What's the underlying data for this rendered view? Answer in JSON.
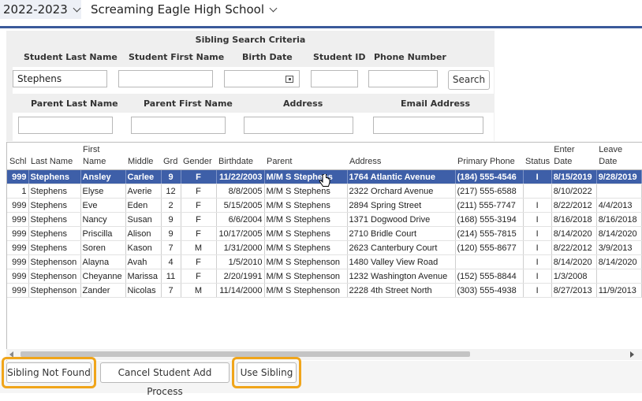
{
  "header": {
    "year": "2022-2023",
    "school": "Screaming Eagle High School"
  },
  "criteria": {
    "title": "Sibling Search Criteria",
    "labels": {
      "student_last": "Student Last Name",
      "student_first": "Student First Name",
      "birth_date": "Birth Date",
      "student_id": "Student ID",
      "phone": "Phone Number",
      "parent_last": "Parent Last Name",
      "parent_first": "Parent First Name",
      "address": "Address",
      "email": "Email Address"
    },
    "values": {
      "student_last": "Stephens",
      "student_first": "",
      "birth_date": "",
      "student_id": "",
      "phone": "",
      "parent_last": "",
      "parent_first": "",
      "address": "",
      "email": ""
    },
    "search_label": "Search"
  },
  "table": {
    "columns": [
      {
        "label": "Schl"
      },
      {
        "label": "Last Name"
      },
      {
        "label": "First Name"
      },
      {
        "label": "Middle"
      },
      {
        "label": "Grd"
      },
      {
        "label": "Gender"
      },
      {
        "label": "Birthdate"
      },
      {
        "label": "Parent"
      },
      {
        "label": "Address"
      },
      {
        "label": "Primary Phone"
      },
      {
        "label": "Status"
      },
      {
        "label": "Enter Date"
      },
      {
        "label": "Leave Date"
      }
    ],
    "rows": [
      {
        "selected": true,
        "cells": [
          "999",
          "Stephens",
          "Ansley",
          "Carlee",
          "9",
          "F",
          "11/22/2003",
          "M/M S Stephens",
          "1764 Atlantic Avenue",
          "(184) 555-4546",
          "I",
          "8/15/2019",
          "9/28/2019"
        ]
      },
      {
        "selected": false,
        "cells": [
          "1",
          "Stephens",
          "Elyse",
          "Averie",
          "12",
          "F",
          "8/8/2005",
          "M/M S Stephens",
          "2322 Orchard Avenue",
          "(217) 555-6588",
          "",
          "8/10/2022",
          ""
        ]
      },
      {
        "selected": false,
        "cells": [
          "999",
          "Stephens",
          "Eve",
          "Eden",
          "2",
          "F",
          "5/15/2005",
          "M/M S Stephens",
          "2894 Spring Street",
          "(211) 555-7747",
          "I",
          "8/22/2012",
          "4/4/2013"
        ]
      },
      {
        "selected": false,
        "cells": [
          "999",
          "Stephens",
          "Nancy",
          "Susan",
          "9",
          "F",
          "6/6/2004",
          "M/M S Stephens",
          "1371 Dogwood Drive",
          "(168) 555-3194",
          "I",
          "8/16/2018",
          "8/16/2018"
        ]
      },
      {
        "selected": false,
        "cells": [
          "999",
          "Stephens",
          "Priscilla",
          "Alison",
          "9",
          "F",
          "10/17/2005",
          "M/M S Stephens",
          "2710 Bridle Court",
          "(214) 555-7815",
          "I",
          "8/14/2020",
          "8/14/2020"
        ]
      },
      {
        "selected": false,
        "cells": [
          "999",
          "Stephens",
          "Soren",
          "Kason",
          "7",
          "M",
          "1/31/2000",
          "M/M S Stephens",
          "2623 Canterbury Court",
          "(120) 555-8677",
          "I",
          "8/22/2012",
          "3/9/2013"
        ]
      },
      {
        "selected": false,
        "cells": [
          "999",
          "Stephenson",
          "Alayna",
          "Avah",
          "4",
          "F",
          "1/5/2010",
          "M/M S Stephenson",
          "1480 Valley View Road",
          "",
          "I",
          "8/14/2020",
          "8/14/2020"
        ]
      },
      {
        "selected": false,
        "cells": [
          "999",
          "Stephenson",
          "Cheyanne",
          "Marissa",
          "11",
          "F",
          "2/20/1991",
          "M/M S Stephenson",
          "1232 Washington Avenue",
          "(152) 555-8844",
          "I",
          "1/3/2008",
          ""
        ]
      },
      {
        "selected": false,
        "cells": [
          "999",
          "Stephenson",
          "Zander",
          "Nicolas",
          "7",
          "M",
          "11/14/2000",
          "M/M S Stephenson",
          "2228 4th Street North",
          "(303) 555-4938",
          "I",
          "8/27/2013",
          "11/9/2013"
        ]
      }
    ]
  },
  "footer": {
    "not_found_label": "Sibling Not Found",
    "cancel_label": "Cancel Student Add Process",
    "use_label": "Use Sibling"
  },
  "colors": {
    "accent": "#3b5a9a",
    "selected_row": "#3e5fa8",
    "highlight": "#f0a51b"
  }
}
